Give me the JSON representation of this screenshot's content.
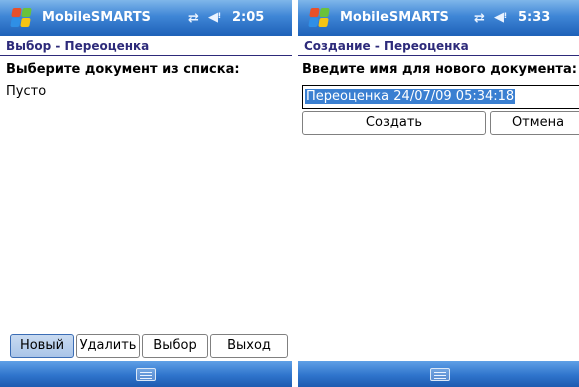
{
  "left_screen": {
    "app_title": "MobileSMARTS",
    "clock": "2:05",
    "subtitle": "Выбор - Переоценка",
    "prompt": "Выберите документ из списка:",
    "list_empty_text": "Пусто",
    "buttons": {
      "new": "Новый",
      "delete": "Удалить",
      "select": "Выбор",
      "exit": "Выход"
    }
  },
  "right_screen": {
    "app_title": "MobileSMARTS",
    "clock": "5:33",
    "subtitle": "Создание - Переоценка",
    "prompt": "Введите имя для нового документа:",
    "name_input_value": "Переоценка 24/07/09 05:34:18",
    "buttons": {
      "create": "Создать",
      "cancel": "Отмена"
    }
  },
  "icons": {
    "start": "windows-flag-icon",
    "connectivity": "connectivity-arrows-icon",
    "volume": "volume-speaker-icon",
    "keyboard": "keyboard-icon"
  },
  "colors": {
    "titlebar": "#3f86d6",
    "subtitle_text": "#2d2a7a",
    "selection": "#3a7fd1"
  }
}
